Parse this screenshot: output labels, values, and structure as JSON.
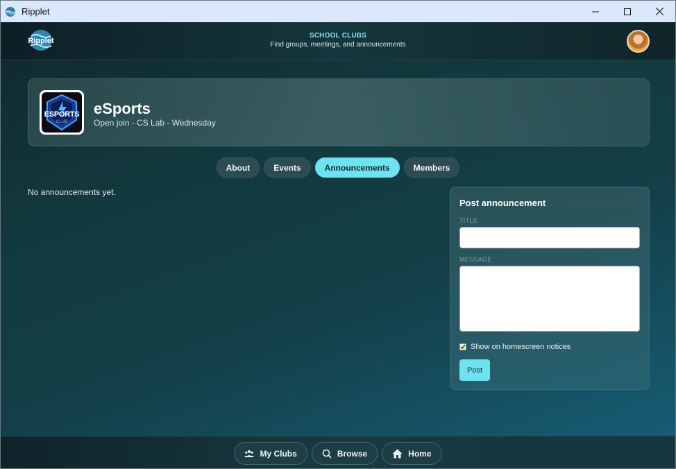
{
  "window": {
    "title": "Ripplet"
  },
  "header": {
    "logo_text": "Ripplet",
    "title": "SCHOOL CLUBS",
    "subtitle": "Find groups, meetings, and announcements"
  },
  "club": {
    "name": "eSports",
    "meta": "Open join - CS Lab - Wednesday",
    "logo_text": "ESPORTS",
    "logo_subtext": "CLUB"
  },
  "tabs": [
    {
      "label": "About",
      "active": false
    },
    {
      "label": "Events",
      "active": false
    },
    {
      "label": "Announcements",
      "active": true
    },
    {
      "label": "Members",
      "active": false
    }
  ],
  "announcements": {
    "empty_text": "No announcements yet."
  },
  "post_form": {
    "title": "Post announcement",
    "title_label": "TITLE",
    "title_value": "",
    "message_label": "MESSAGE",
    "message_value": "",
    "homescreen_checkbox_label": "Show on homescreen notices",
    "homescreen_checked": true,
    "submit_label": "Post"
  },
  "bottom_nav": [
    {
      "label": "My Clubs",
      "icon": "group-icon"
    },
    {
      "label": "Browse",
      "icon": "search-icon"
    },
    {
      "label": "Home",
      "icon": "home-icon"
    }
  ],
  "colors": {
    "accent": "#6fe2ef",
    "header_title": "#7ee3ee"
  }
}
